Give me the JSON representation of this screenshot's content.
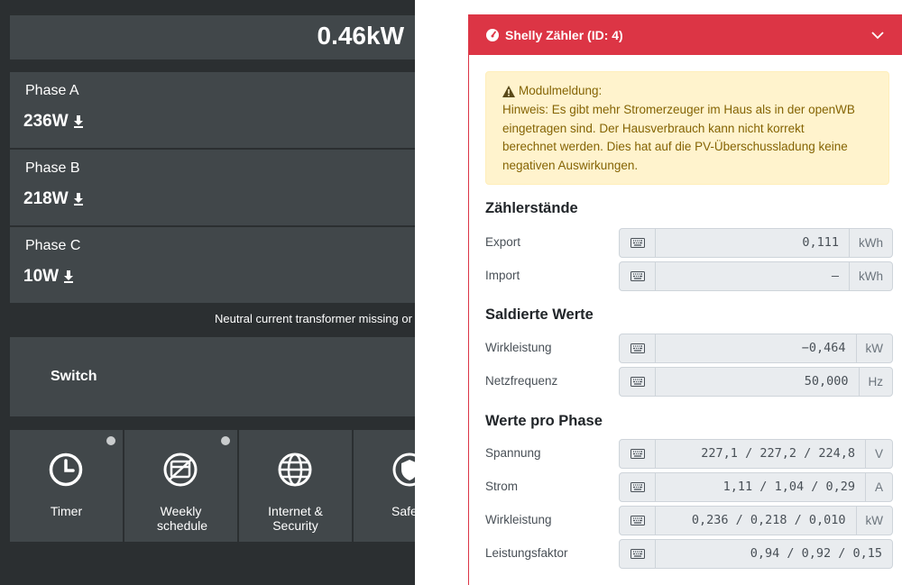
{
  "shelly": {
    "total_power": "0.46kW",
    "phases": [
      {
        "name": "Phase A",
        "value": "236W"
      },
      {
        "name": "Phase B",
        "value": "218W"
      },
      {
        "name": "Phase C",
        "value": "10W"
      }
    ],
    "notice": "Neutral current transformer missing or",
    "switch_label": "Switch",
    "tiles": [
      {
        "label": "Timer",
        "icon": "clock-icon"
      },
      {
        "label": "Weekly schedule",
        "icon": "calendar-icon"
      },
      {
        "label": "Internet & Security",
        "icon": "globe-icon"
      },
      {
        "label": "Safe",
        "icon": "shield-icon"
      }
    ]
  },
  "panel": {
    "title": "Shelly Zähler (ID: 4)",
    "accent": "#dc3545",
    "alert": {
      "title": "Modulmeldung:",
      "lines": [
        "Hinweis: Es gibt mehr Stromerzeuger im Haus als in der openWB",
        "eingetragen sind. Der Hausverbrauch kann nicht korrekt",
        "berechnet werden. Dies hat auf die PV-Überschussladung keine",
        "negativen Auswirkungen."
      ]
    },
    "sections": {
      "zaehlerstaende": "Zählerstände",
      "saldierte": "Saldierte Werte",
      "pro_phase": "Werte pro Phase"
    },
    "rows": {
      "export": {
        "label": "Export",
        "value": "0,111",
        "unit": "kWh"
      },
      "import": {
        "label": "Import",
        "value": "–",
        "unit": "kWh"
      },
      "wirkleistung_total": {
        "label": "Wirkleistung",
        "value": "−0,464",
        "unit": "kW"
      },
      "netzfrequenz": {
        "label": "Netzfrequenz",
        "value": "50,000",
        "unit": "Hz"
      },
      "spannung": {
        "label": "Spannung",
        "value": "227,1 / 227,2 / 224,8",
        "unit": "V"
      },
      "strom": {
        "label": "Strom",
        "value": "1,11 / 1,04 / 0,29",
        "unit": "A"
      },
      "wirkleistung_phase": {
        "label": "Wirkleistung",
        "value": "0,236 / 0,218 / 0,010",
        "unit": "kW"
      },
      "leistungsfaktor": {
        "label": "Leistungsfaktor",
        "value": "0,94 / 0,92 / 0,15",
        "unit": ""
      }
    }
  }
}
